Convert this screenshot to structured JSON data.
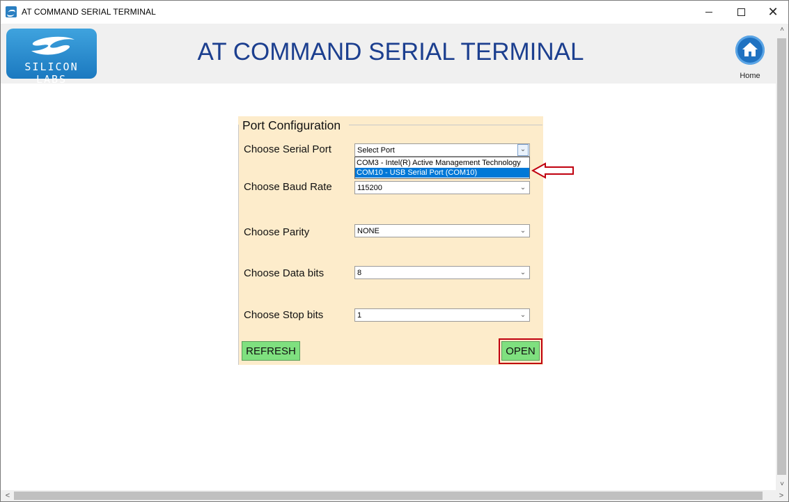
{
  "window": {
    "title": "AT COMMAND SERIAL TERMINAL",
    "minimize_icon": "minimize-icon",
    "maximize_icon": "maximize-icon",
    "close_icon": "close-icon",
    "close_glyph": "✕"
  },
  "header": {
    "logo_text": "SILICON LABS",
    "title": "AT COMMAND SERIAL TERMINAL",
    "home_label": "Home",
    "home_icon": "home-icon"
  },
  "port_config": {
    "title": "Port Configuration",
    "serial_port": {
      "label": "Choose Serial Port",
      "value": "Select Port",
      "options": [
        "COM3 - Intel(R) Active Management Technology",
        "COM10 - USB Serial Port (COM10)"
      ],
      "highlighted_option": 1
    },
    "baud_rate": {
      "label": "Choose Baud Rate",
      "value": "115200"
    },
    "parity": {
      "label": "Choose Parity",
      "value": "NONE"
    },
    "data_bits": {
      "label": "Choose Data bits",
      "value": "8"
    },
    "stop_bits": {
      "label": "Choose Stop bits",
      "value": "1"
    },
    "refresh_label": "REFRESH",
    "open_label": "OPEN"
  },
  "scrollbars": {
    "up_glyph": "˄",
    "down_glyph": "˅",
    "left_glyph": "<",
    "right_glyph": ">"
  },
  "colors": {
    "panel_bg": "#fdeccb",
    "button_green": "#7fe07f",
    "highlight_red": "#c0000f",
    "title_blue": "#1c3f8f",
    "selection_blue": "#0078d7"
  }
}
